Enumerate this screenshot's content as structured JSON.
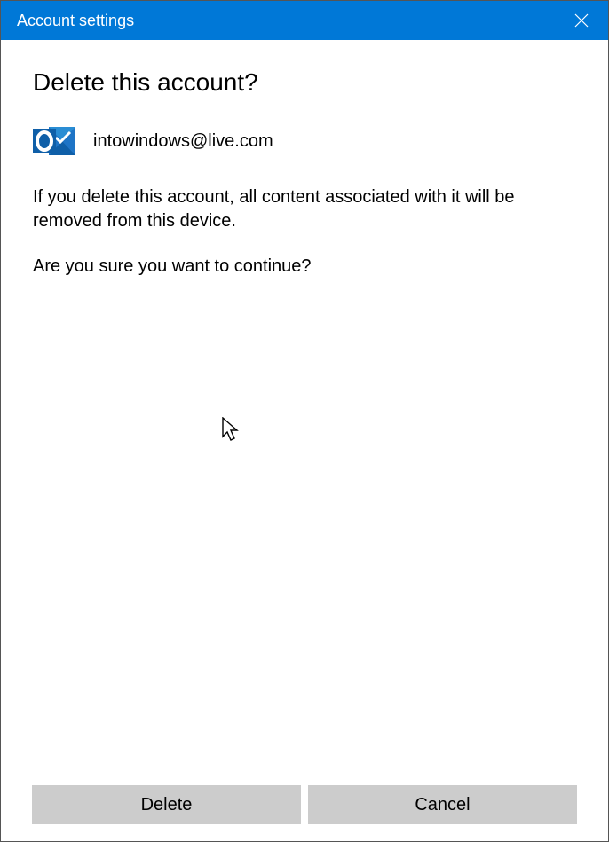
{
  "titlebar": {
    "title": "Account settings"
  },
  "dialog": {
    "heading": "Delete this account?",
    "email": "intowindows@live.com",
    "warning_text": "If you delete this account, all content associated with it will be removed from this device.",
    "confirm_text": "Are you sure you want to continue?"
  },
  "buttons": {
    "delete": "Delete",
    "cancel": "Cancel"
  },
  "colors": {
    "accent": "#0078d7",
    "button_bg": "#cccccc"
  }
}
